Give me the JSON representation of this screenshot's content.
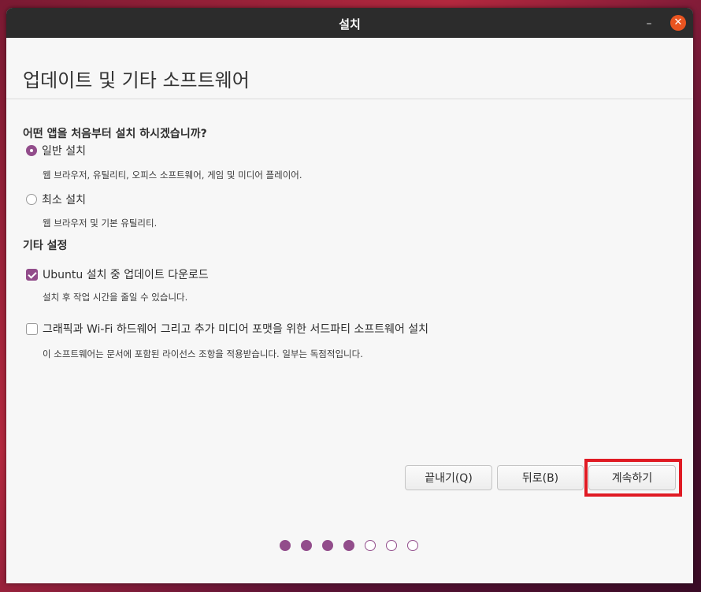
{
  "window": {
    "title": "설치",
    "minimize_glyph": "–",
    "close_glyph": "✕"
  },
  "header": {
    "title": "업데이트 및 기타 소프트웨어"
  },
  "install_type": {
    "question": "어떤 앱을 처음부터 설치 하시겠습니까?",
    "normal": {
      "label": "일반 설치",
      "description": "웹 브라우저, 유틸리티, 오피스  소프트웨어, 게임 및 미디어 플레이어.",
      "selected": true
    },
    "minimal": {
      "label": "최소 설치",
      "description": "웹 브라우저 및 기본 유틸리티.",
      "selected": false
    }
  },
  "other_settings": {
    "title": "기타 설정",
    "download_updates": {
      "label": "Ubuntu 설치 중 업데이트 다운로드",
      "description": "설치 후 작업 시간을 줄일 수 있습니다.",
      "checked": true
    },
    "third_party": {
      "label": "그래픽과 Wi-Fi 하드웨어 그리고 추가 미디어 포맷을 위한 서드파티 소프트웨어 설치",
      "description": "이 소프트웨어는 문서에 포함된 라이선스 조항을 적용받습니다. 일부는 독점적입니다.",
      "checked": false
    }
  },
  "buttons": {
    "quit": "끝내기(Q)",
    "back": "뒤로(B)",
    "continue": "계속하기"
  },
  "progress": {
    "total_steps": 7,
    "completed_steps": 4
  },
  "colors": {
    "accent": "#924d8b",
    "close": "#e95420",
    "highlight": "#e01b24"
  }
}
